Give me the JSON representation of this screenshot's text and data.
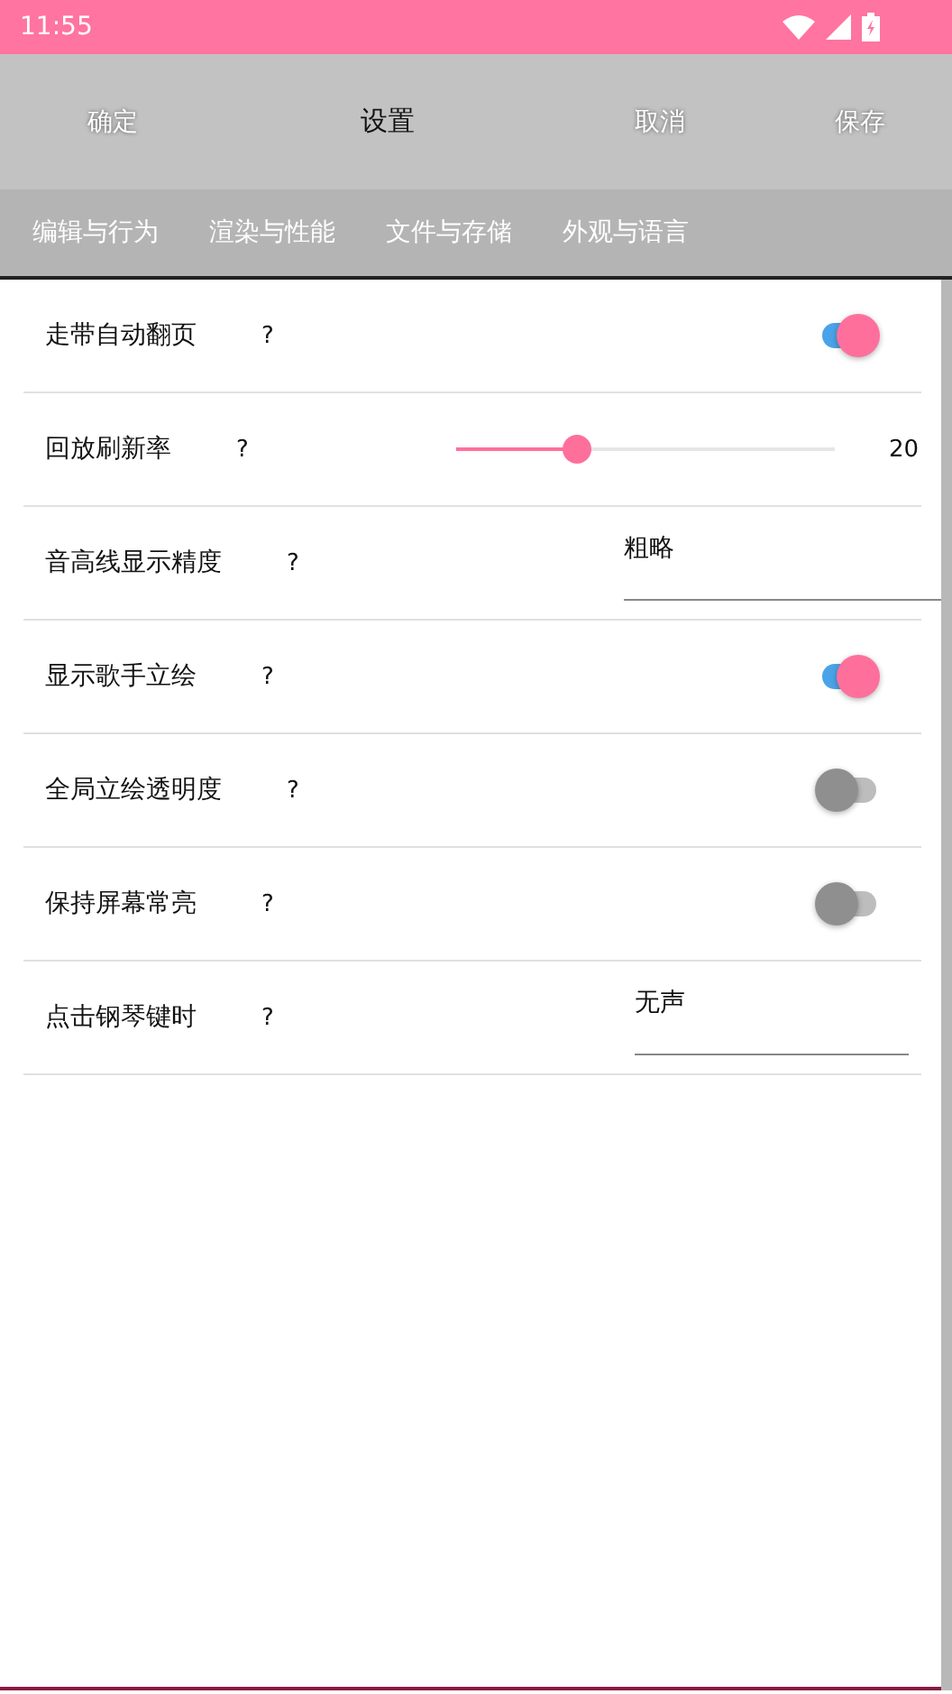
{
  "status_bar": {
    "time": "11:55"
  },
  "toolbar": {
    "buttons": [
      {
        "label": "确定",
        "kind": "action"
      },
      {
        "label": "设置",
        "kind": "title"
      },
      {
        "label": "取消",
        "kind": "action"
      },
      {
        "label": "保存",
        "kind": "action"
      }
    ]
  },
  "tabs": [
    {
      "label": "编辑与行为"
    },
    {
      "label": "渲染与性能"
    },
    {
      "label": "文件与存储"
    },
    {
      "label": "外观与语言"
    }
  ],
  "settings": [
    {
      "kind": "switch",
      "label": "走带自动翻页",
      "help": "?",
      "on": true
    },
    {
      "kind": "slider",
      "label": "回放刷新率",
      "help": "?",
      "level": 0.32,
      "reading": "20"
    },
    {
      "kind": "dropdown",
      "label": "音高线显示精度",
      "help": "?",
      "value": "粗略",
      "wide": true
    },
    {
      "kind": "switch",
      "label": "显示歌手立绘",
      "help": "?",
      "on": true
    },
    {
      "kind": "switch",
      "label": "全局立绘透明度",
      "help": "?",
      "on": false
    },
    {
      "kind": "switch",
      "label": "保持屏幕常亮",
      "help": "?",
      "on": false
    },
    {
      "kind": "dropdown",
      "label": "点击钢琴键时",
      "help": "?",
      "value": "无声",
      "wide": false
    }
  ]
}
